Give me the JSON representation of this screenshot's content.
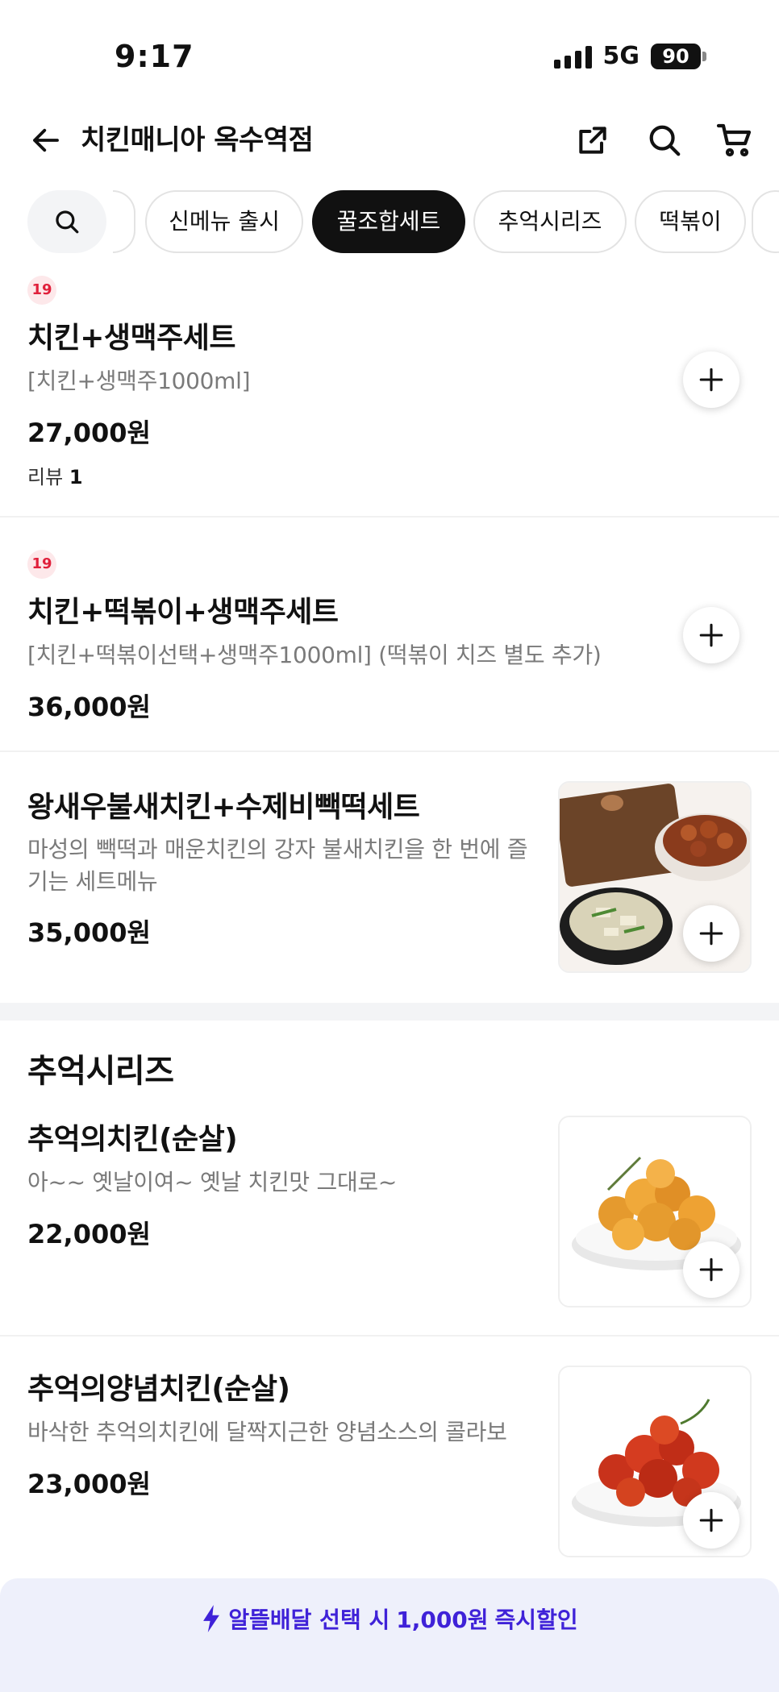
{
  "status": {
    "time": "9:17",
    "network": "5G",
    "battery": "90"
  },
  "header": {
    "title": "치킨매니아 옥수역점"
  },
  "chips": [
    "신메뉴 출시",
    "꿀조합세트",
    "추억시리즈",
    "떡볶이"
  ],
  "items": [
    {
      "badge": "19",
      "name": "치킨+생맥주세트",
      "desc": "[치킨+생맥주1000ml]",
      "price": "27,000원",
      "review_label": "리뷰",
      "review_count": "1"
    },
    {
      "badge": "19",
      "name": "치킨+떡볶이+생맥주세트",
      "desc": "[치킨+떡볶이선택+생맥주1000ml] (떡볶이 치즈 별도 추가)",
      "price": "36,000원"
    },
    {
      "name": "왕새우불새치킨+수제비빽떡세트",
      "desc": "마성의 빽떡과 매운치킨의 강자 불새치킨을 한 번에 즐기는 세트메뉴",
      "price": "35,000원"
    }
  ],
  "section": {
    "title": "추억시리즈",
    "items": [
      {
        "name": "추억의치킨(순살)",
        "desc": "아~~ 옛날이여~ 옛날 치킨맛 그대로~",
        "price": "22,000원"
      },
      {
        "name": "추억의양념치킨(순살)",
        "desc": "바삭한 추억의치킨에 달짝지근한 양념소스의 콜라보",
        "price": "23,000원"
      }
    ]
  },
  "promo": {
    "prefix": "알뜰배달 선택 시",
    "amount": "1,000원",
    "suffix": "즉시할인"
  },
  "colors": {
    "accent": "#3f22d8",
    "badge": "#e0203b",
    "active_chip": "#111111"
  }
}
